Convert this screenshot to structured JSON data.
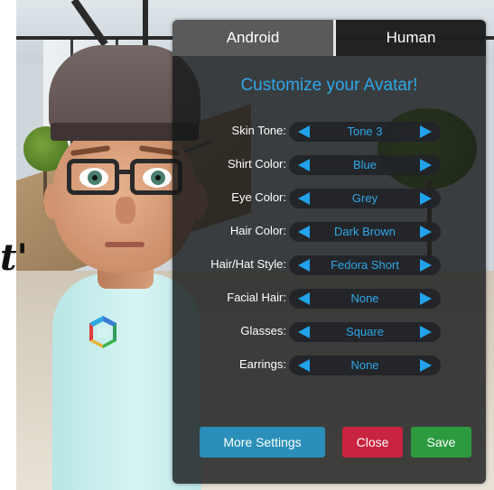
{
  "edge_glyph": "t'",
  "tabs": [
    {
      "label": "Android",
      "active": false
    },
    {
      "label": "Human",
      "active": true
    }
  ],
  "title": "Customize your Avatar!",
  "options": [
    {
      "label": "Skin Tone:",
      "value": "Tone 3"
    },
    {
      "label": "Shirt Color:",
      "value": "Blue"
    },
    {
      "label": "Eye Color:",
      "value": "Grey"
    },
    {
      "label": "Hair Color:",
      "value": "Dark Brown"
    },
    {
      "label": "Hair/Hat Style:",
      "value": "Fedora Short"
    },
    {
      "label": "Facial Hair:",
      "value": "None"
    },
    {
      "label": "Glasses:",
      "value": "Square"
    },
    {
      "label": "Earrings:",
      "value": "None"
    }
  ],
  "buttons": {
    "more_settings": "More Settings",
    "close": "Close",
    "save": "Save"
  },
  "colors": {
    "accent": "#2ea8ea",
    "close": "#c8243f",
    "save": "#2d9a40",
    "more": "#2a8fb9"
  },
  "icons": {
    "prev": "left-arrow-icon",
    "next": "right-arrow-icon",
    "shirt_logo": "cube-logo-icon"
  }
}
